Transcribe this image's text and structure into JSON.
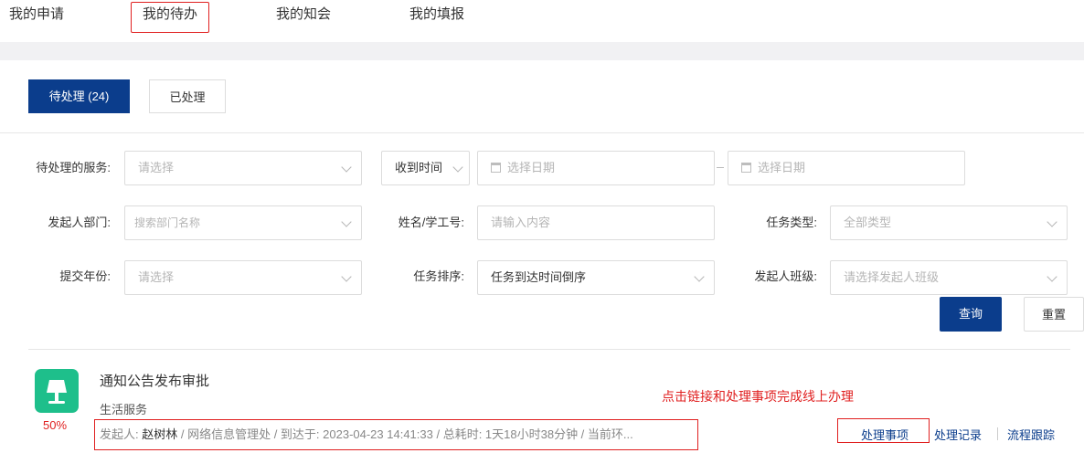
{
  "top_tabs": [
    "我的申请",
    "我的待办",
    "我的知会",
    "我的填报"
  ],
  "status_tabs": {
    "pending": "待处理 (24)",
    "done": "已处理"
  },
  "filters": {
    "service_label": "待处理的服务:",
    "service_placeholder": "请选择",
    "time_select": "收到时间",
    "date_placeholder": "选择日期",
    "dept_label": "发起人部门:",
    "dept_placeholder": "搜索部门名称",
    "name_label": "姓名/学工号:",
    "name_placeholder": "请输入内容",
    "type_label": "任务类型:",
    "type_value": "全部类型",
    "year_label": "提交年份:",
    "year_placeholder": "请选择",
    "sort_label": "任务排序:",
    "sort_value": "任务到达时间倒序",
    "class_label": "发起人班级:",
    "class_placeholder": "请选择发起人班级",
    "query_btn": "查询",
    "reset_btn": "重置"
  },
  "item": {
    "progress": "50%",
    "title": "通知公告发布审批",
    "category": "生活服务",
    "meta_prefix": "发起人: ",
    "initiator": "赵树林",
    "meta_rest": " / 网络信息管理处 / 到达于: 2023-04-23 14:41:33 / 总耗时: 1天18小时38分钟 / 当前环...",
    "note": "点击链接和处理事项完成线上办理",
    "actions": [
      "处理事项",
      "处理记录",
      "流程跟踪"
    ]
  },
  "colors": {
    "primary": "#0b3d8c",
    "highlight": "#e02020",
    "icon_bg": "#1ebf8b"
  }
}
